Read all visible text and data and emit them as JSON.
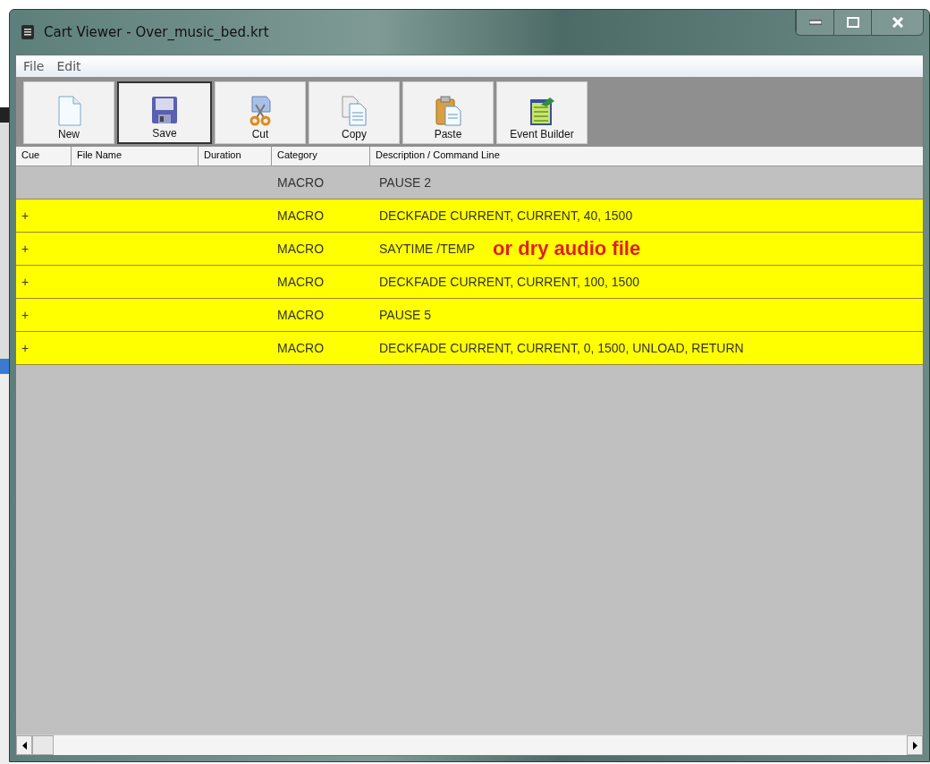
{
  "window": {
    "title": "Cart Viewer - Over_music_bed.krt"
  },
  "menu": [
    "File",
    "Edit"
  ],
  "toolbar": [
    {
      "label": "New",
      "kind": "new",
      "selected": false
    },
    {
      "label": "Save",
      "kind": "save",
      "selected": true
    },
    {
      "label": "Cut",
      "kind": "cut",
      "selected": false
    },
    {
      "label": "Copy",
      "kind": "copy",
      "selected": false
    },
    {
      "label": "Paste",
      "kind": "paste",
      "selected": false
    },
    {
      "label": "Event Builder",
      "kind": "event",
      "selected": false
    }
  ],
  "table": {
    "columns": [
      "Cue",
      "File Name",
      "Duration",
      "Category",
      "Description / Command Line"
    ],
    "rows": [
      {
        "category": "MACRO",
        "description": "PAUSE 2",
        "highlighted": false
      },
      {
        "cue": "+",
        "category": "MACRO",
        "description": "DECKFADE CURRENT, CURRENT, 40, 1500",
        "highlighted": true
      },
      {
        "cue": "+",
        "category": "MACRO",
        "description": "SAYTIME /TEMP",
        "annotation": "or dry audio file",
        "highlighted": true
      },
      {
        "cue": "+",
        "category": "MACRO",
        "description": "DECKFADE CURRENT, CURRENT, 100, 1500",
        "highlighted": true
      },
      {
        "cue": "+",
        "category": "MACRO",
        "description": "PAUSE 5",
        "highlighted": true
      },
      {
        "cue": "+",
        "category": "MACRO",
        "description": "DECKFADE CURRENT, CURRENT, 0, 1500, UNLOAD, RETURN",
        "highlighted": true
      }
    ]
  }
}
